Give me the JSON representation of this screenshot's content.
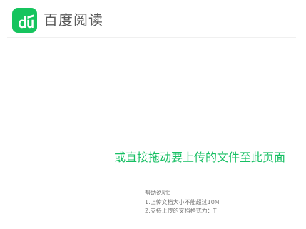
{
  "header": {
    "logo_text": "du",
    "app_title": "百度阅读",
    "brand_color": "#16c45e"
  },
  "upload": {
    "drop_hint": "或直接拖动要上传的文件至此页面",
    "hint_color": "#17bf63"
  },
  "help": {
    "title": "帮助说明：",
    "items": [
      "1.上传文档大小不能超过10M",
      "2.支持上传的文档格式为：T"
    ]
  }
}
